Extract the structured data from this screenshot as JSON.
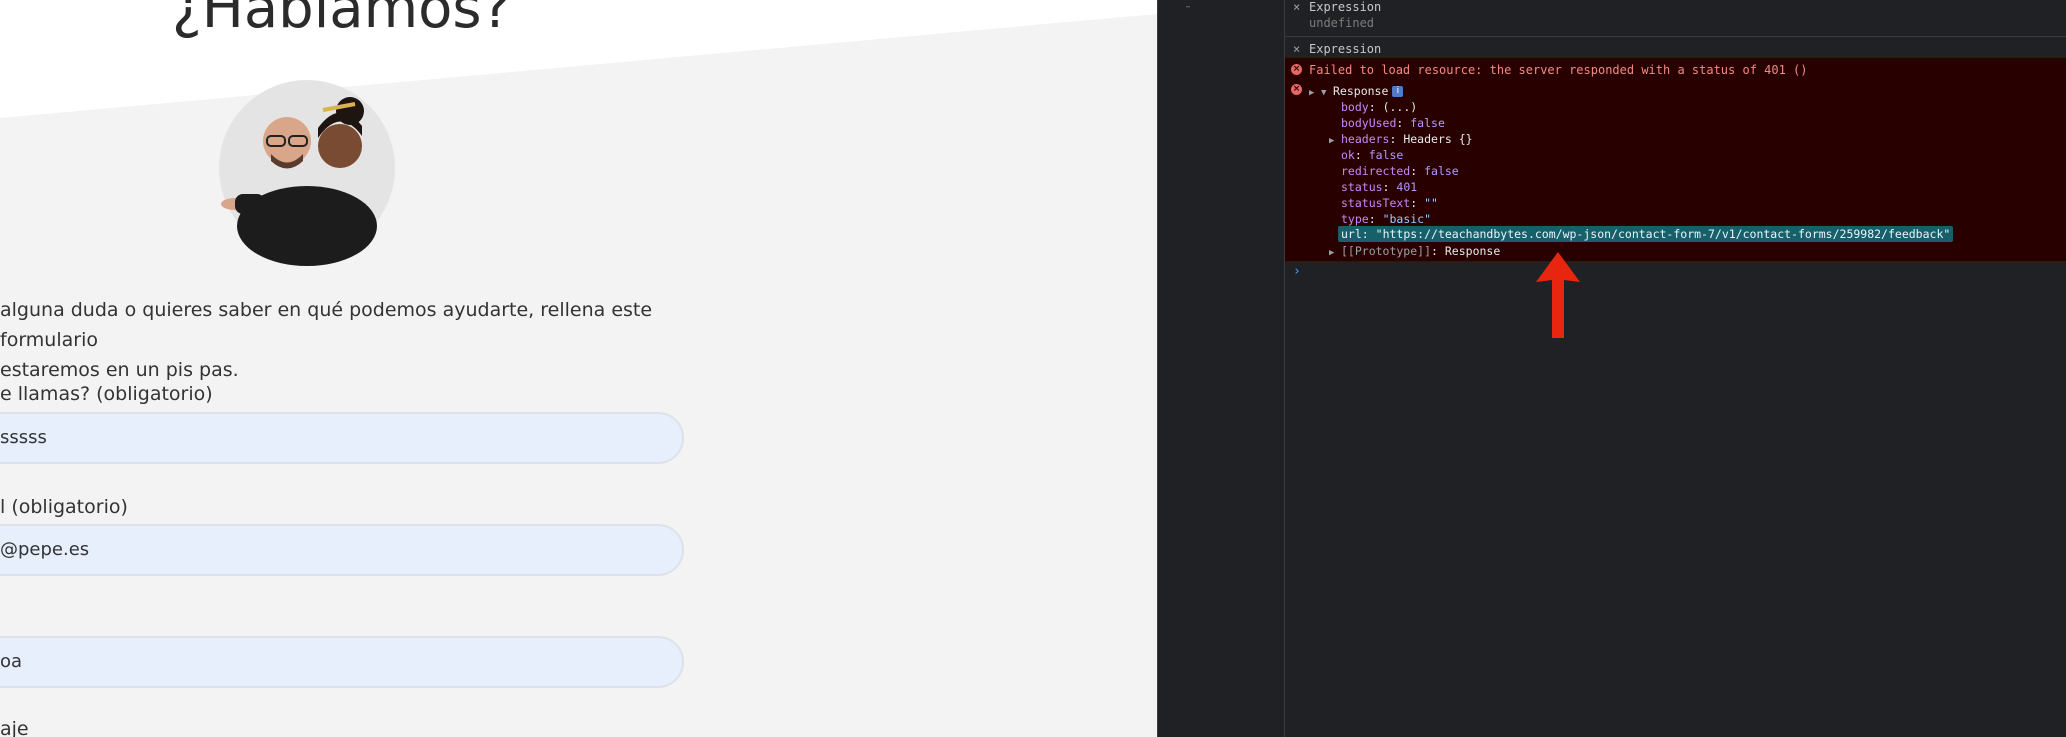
{
  "page": {
    "title": "¿Hablamos?",
    "intro_line1": "alguna duda o quieres saber en qué podemos ayudarte, rellena este formulario",
    "intro_line2": "estaremos en un pis pas.",
    "fields": [
      {
        "label": "e llamas? (obligatorio)",
        "value": "sssss"
      },
      {
        "label": "l (obligatorio)",
        "value": "@pepe.es"
      },
      {
        "label": "",
        "value": "oa"
      }
    ],
    "message_label": "aje"
  },
  "devtools": {
    "expressions": [
      {
        "name": "Expression",
        "value": "undefined"
      },
      {
        "name": "Expression",
        "value": ""
      }
    ],
    "error_message": "Failed to load resource: the server responded with a status of 401 ()",
    "response": {
      "type_name": "Response",
      "badge": "i",
      "props": [
        {
          "key": "body",
          "value": "(...)",
          "kind": "plain"
        },
        {
          "key": "bodyUsed",
          "value": "false",
          "kind": "bool"
        },
        {
          "key": "headers",
          "value": "Headers {}",
          "kind": "plain",
          "expandable": true
        },
        {
          "key": "ok",
          "value": "false",
          "kind": "bool"
        },
        {
          "key": "redirected",
          "value": "false",
          "kind": "bool"
        },
        {
          "key": "status",
          "value": "401",
          "kind": "num"
        },
        {
          "key": "statusText",
          "value": "\"\"",
          "kind": "str"
        },
        {
          "key": "type",
          "value": "\"basic\"",
          "kind": "str"
        },
        {
          "key": "url",
          "value": "\"https://teachandbytes.com/wp-json/contact-form-7/v1/contact-forms/259982/feedback\"",
          "kind": "str",
          "highlighted": true
        }
      ],
      "prototype_key": "[[Prototype]]",
      "prototype_value": "Response"
    },
    "prompt_symbol": "›",
    "annotation_arrow_color": "#e8260f"
  }
}
